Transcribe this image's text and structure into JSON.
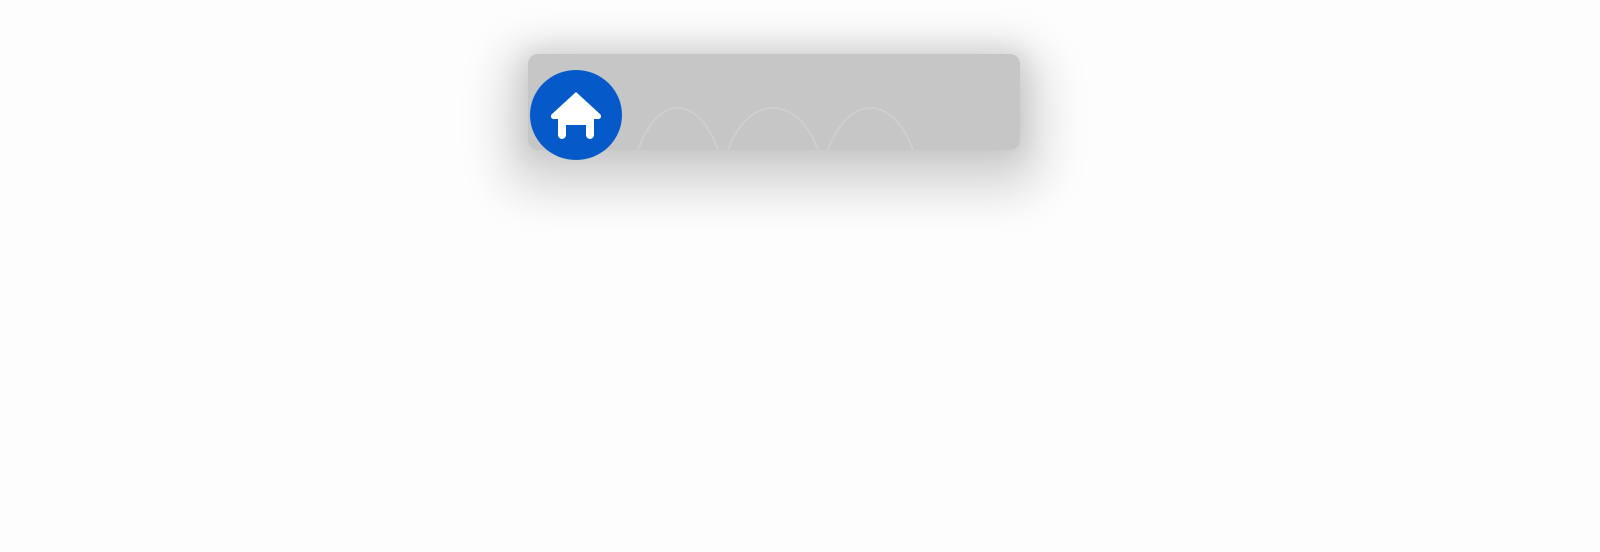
{
  "nav": {
    "home_icon": "home-icon",
    "accent_color": "#0659c9",
    "bar_color": "#c6c6c6"
  }
}
